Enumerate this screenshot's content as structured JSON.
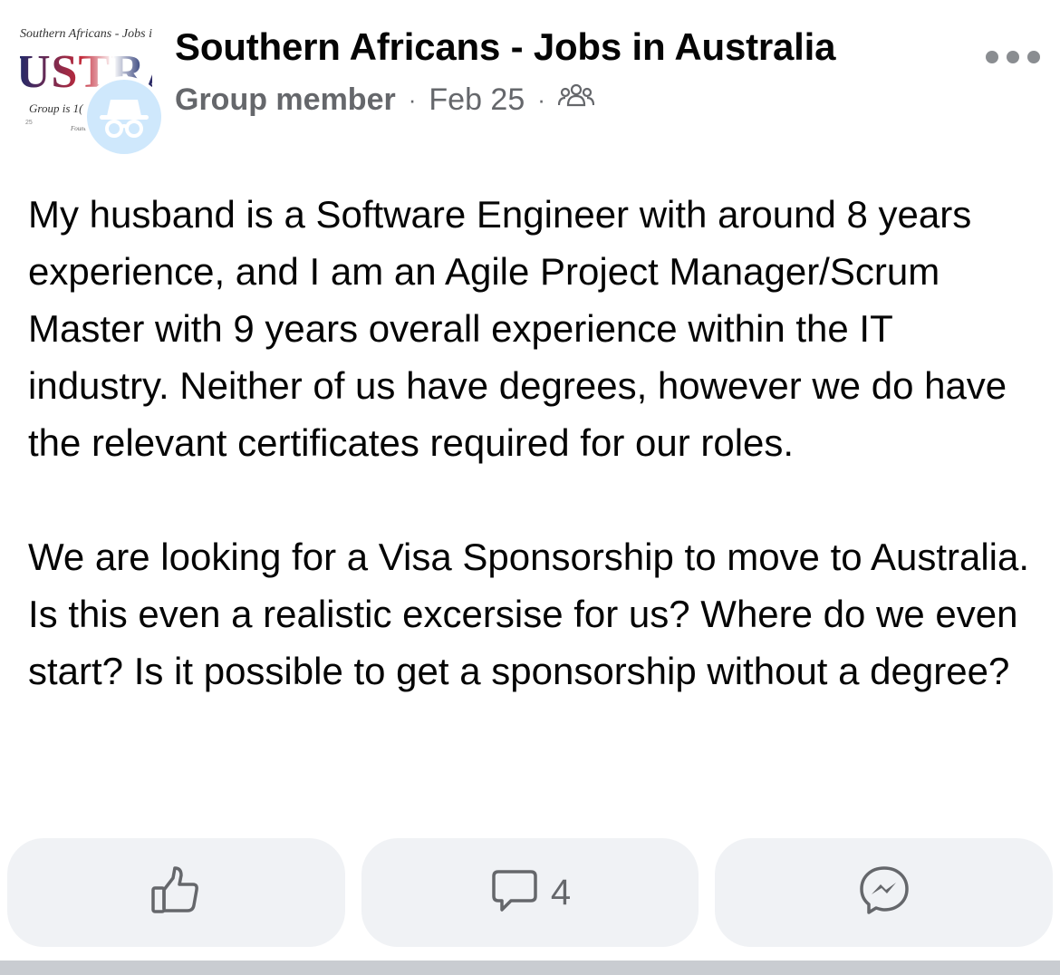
{
  "post": {
    "group_name": "Southern Africans - Jobs in Australia",
    "author_role": "Group member",
    "separator": "·",
    "date": "Feb 25",
    "audience_icon": "group-icon",
    "more_icon": "ellipsis-icon",
    "group_image": {
      "line1": "Southern Africans - Jobs in",
      "word": "USTRALI",
      "line2": "Group is 1(",
      "corner": "25",
      "signature": "Founda"
    },
    "avatar_icon": "anonymous-member-icon",
    "avatar_color": "#cfe8fc",
    "body": [
      "My husband is a Software Engineer with around 8 years experience, and I am an Agile Project Manager/Scrum Master with 9 years overall experience within the IT industry. Neither of us have degrees, however we do have the relevant certificates required for our roles.",
      "We are looking for a Visa Sponsorship to move to Australia. Is this even a realistic excersise for us? Where do we even start? Is it possible to get a sponsorship without a degree?"
    ]
  },
  "actions": {
    "like_icon": "thumbs-up-icon",
    "comment_icon": "comment-icon",
    "comment_count": "4",
    "share_icon": "messenger-icon"
  },
  "colors": {
    "text": "#050505",
    "secondary": "#65676b",
    "button_bg": "#f0f2f5",
    "icon": "#65676b"
  }
}
